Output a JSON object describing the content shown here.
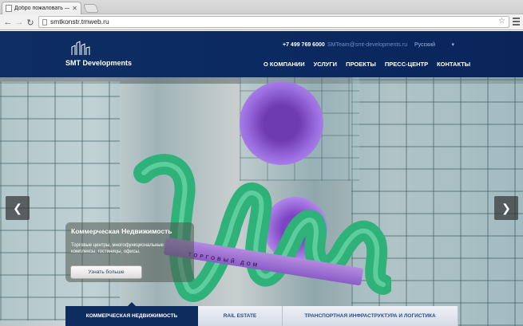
{
  "browser": {
    "tab_title": "Добро пожаловать — SM",
    "tab_close": "✕",
    "url": "smtkonstr.tmweb.ru",
    "nav": {
      "back": "←",
      "forward": "→",
      "reload": "↻",
      "star": "☆"
    }
  },
  "header": {
    "logo_text": "SMT Developments",
    "phone": "+7 499 769 6000",
    "email": "SMTeam@smt-developments.ru",
    "language": "Русский",
    "language_caret": "▾",
    "nav": [
      "О КОМПАНИИ",
      "УСЛУГИ",
      "ПРОЕКТЫ",
      "ПРЕСС-ЦЕНТР",
      "КОНТАКТЫ"
    ]
  },
  "hero": {
    "sign_text": "ТОРГОВЫЙ ДОМ",
    "prev": "❮",
    "next": "❯",
    "caption_title": "Коммерческая Недвижимость",
    "caption_desc": "Торговые центры, многофункциональные комплексы, гостиницы, офисы.",
    "more_button": "Узнать больше"
  },
  "tabs": [
    "КОММЕРЧЕСКАЯ НЕДВИЖИМОСТЬ",
    "RAIL ESTATE",
    "ТРАНСПОРТНАЯ ИНФРАСТРУКТУРА И ЛОГИСТИКА"
  ],
  "colors": {
    "header_bg": "#0e2d63",
    "accent_green": "#2fb27a",
    "accent_purple": "#8a5cc7"
  }
}
